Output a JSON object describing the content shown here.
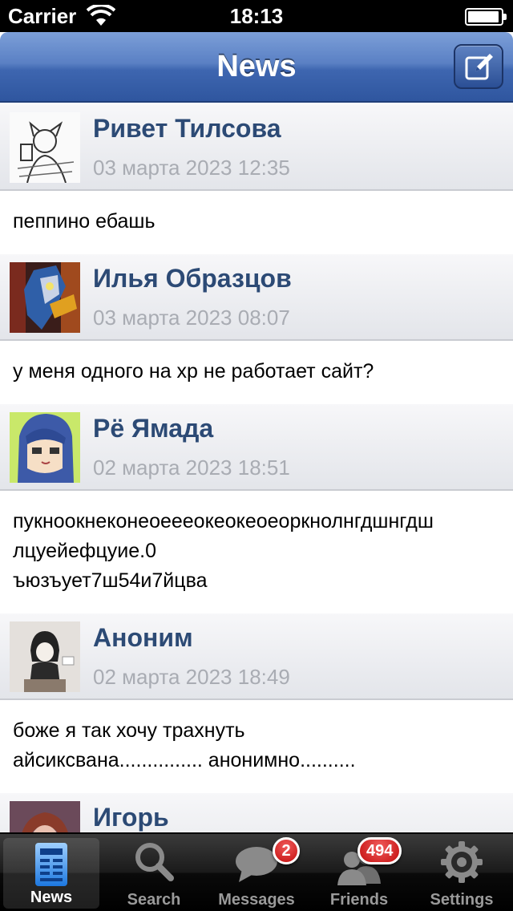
{
  "status_bar": {
    "carrier": "Carrier",
    "time": "18:13"
  },
  "nav": {
    "title": "News",
    "compose_icon": "compose-icon"
  },
  "posts": [
    {
      "author": "Ривет Тилсова",
      "date": "03 марта 2023 12:35",
      "text": "пеппино ебашь"
    },
    {
      "author": "Илья Образцов",
      "date": "03 марта 2023 08:07",
      "text": "у меня одного на хр не работает сайт?"
    },
    {
      "author": "Рё Ямада",
      "date": "02 марта 2023 18:51",
      "text": "пукноокнеконеоеееокеокеоеоркнолнгдшнгдш\nлцуейефцуие.0\nъюзъует7ш54и7йцва"
    },
    {
      "author": "Аноним",
      "date": "02 марта 2023 18:49",
      "text": "боже я так хочу трахнуть\nайсиксвана............... анонимно.........."
    },
    {
      "author": "Игорь",
      "date": "",
      "text": ""
    }
  ],
  "tabs": [
    {
      "label": "News",
      "icon": "news-icon",
      "active": true
    },
    {
      "label": "Search",
      "icon": "search-icon"
    },
    {
      "label": "Messages",
      "icon": "messages-icon",
      "badge": "2"
    },
    {
      "label": "Friends",
      "icon": "friends-icon",
      "badge": "494"
    },
    {
      "label": "Settings",
      "icon": "settings-icon"
    }
  ],
  "colors": {
    "nav_blue": "#3e66b0",
    "author_blue": "#2c4a75",
    "date_gray": "#a9acb3",
    "badge_red": "#c40f0f"
  }
}
